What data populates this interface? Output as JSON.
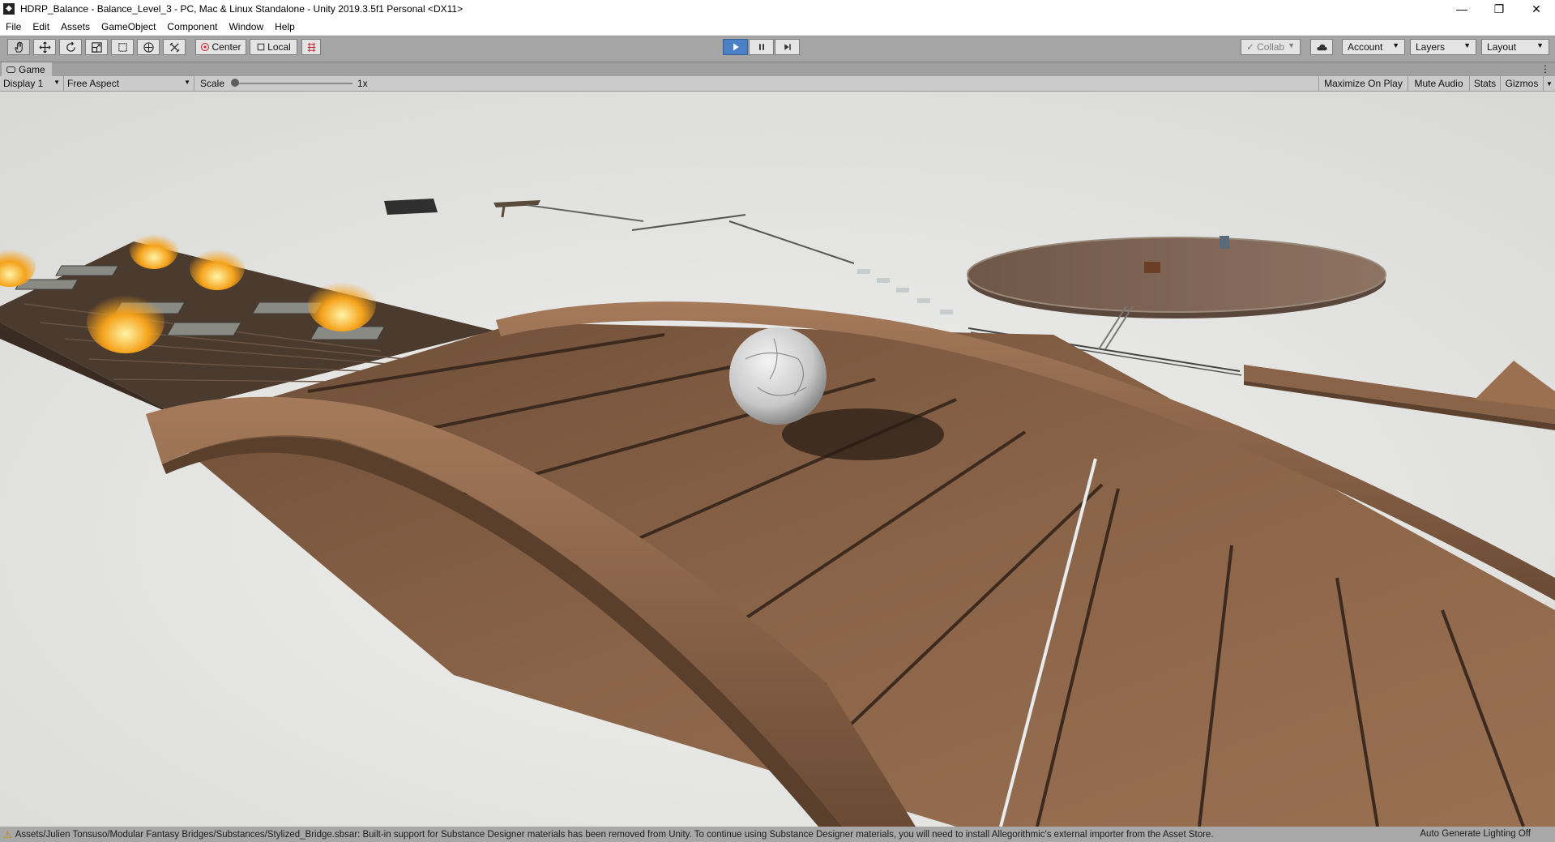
{
  "window": {
    "title": "HDRP_Balance - Balance_Level_3 - PC, Mac & Linux Standalone - Unity 2019.3.5f1 Personal <DX11>",
    "minimize_glyph": "—",
    "maximize_glyph": "❐",
    "close_glyph": "✕"
  },
  "menu": {
    "file": "File",
    "edit": "Edit",
    "assets": "Assets",
    "gameobject": "GameObject",
    "component": "Component",
    "window": "Window",
    "help": "Help"
  },
  "toolbar": {
    "tools": [
      "hand-tool-icon",
      "move-tool-icon",
      "rotate-tool-icon",
      "scale-tool-icon",
      "rect-tool-icon",
      "transform-tool-icon",
      "custom-tool-icon"
    ],
    "pivot_label": "Center",
    "space_label": "Local",
    "collab_label": "Collab",
    "account_label": "Account",
    "layers_label": "Layers",
    "layout_label": "Layout",
    "play_state": "playing"
  },
  "game_tab": {
    "label": "Game"
  },
  "game_controls": {
    "display": "Display 1",
    "aspect": "Free Aspect",
    "scale_label": "Scale",
    "scale_value": "1x",
    "maximize_on_play": "Maximize On Play",
    "mute_audio": "Mute Audio",
    "stats": "Stats",
    "gizmos": "Gizmos"
  },
  "status": {
    "message": "Assets/Julien Tonsuso/Modular Fantasy Bridges/Substances/Stylized_Bridge.sbsar: Built-in support for Substance Designer materials has been removed from Unity. To continue using Substance Designer materials, you will need to install Allegorithmic's external importer from the Asset Store.",
    "lighting": "Auto Generate Lighting Off"
  },
  "colors": {
    "play_active": "#4a80c6",
    "toolbar_bg": "#a5a5a5",
    "sky": "#e8e8e6",
    "wood": "#8a6448",
    "fire": "#f5a21a"
  }
}
